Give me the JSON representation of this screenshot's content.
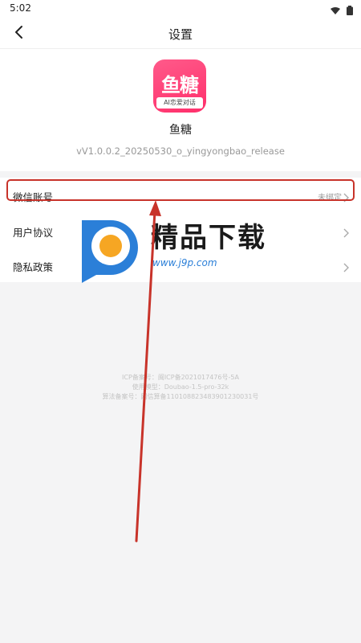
{
  "status_bar": {
    "time": "5:02"
  },
  "nav": {
    "title": "设置"
  },
  "app": {
    "icon_text": "鱼糖",
    "icon_subtext": "AI恋爱对话",
    "name": "鱼糖",
    "version": "vV1.0.0.2_20250530_o_yingyongbao_release"
  },
  "settings": {
    "items": [
      {
        "label": "微信账号",
        "value": "未绑定"
      },
      {
        "label": "用户协议",
        "value": ""
      },
      {
        "label": "隐私政策",
        "value": ""
      }
    ]
  },
  "footer": {
    "icp_line": "ICP备案号：闽ICP备2021017476号-5A",
    "model_line": "使用模型：Doubao-1.5-pro-32k",
    "algo_line": "算法备案号：网信算备110108823483901230031号"
  },
  "watermark": {
    "title": "精品下载",
    "url": "www.j9p.com"
  },
  "colors": {
    "annotation": "#c8332a",
    "brand_pink": "#ff3b74",
    "watermark_blue": "#2b7fd8",
    "watermark_orange": "#f6a623"
  }
}
